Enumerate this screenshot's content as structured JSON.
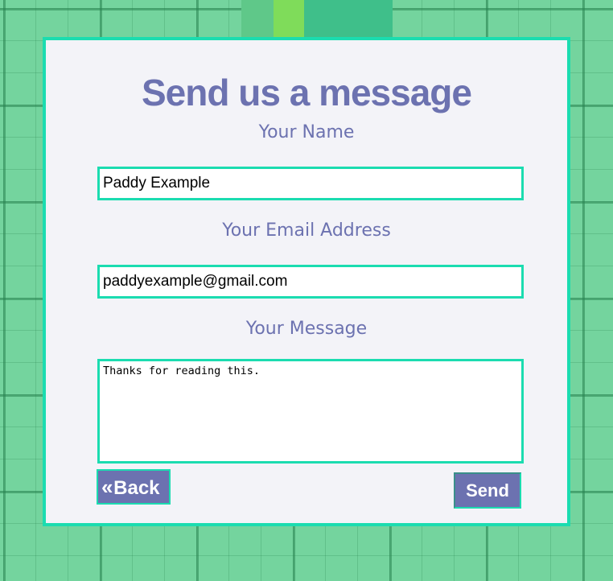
{
  "form": {
    "title": "Send us a message",
    "name_label": "Your Name",
    "name_value": "Paddy Example",
    "email_label": "Your Email Address",
    "email_value": "paddyexample@gmail.com",
    "message_label": "Your Message",
    "message_value": "Thanks for reading this.",
    "back_label": "Back",
    "back_icon": "double-chevron-left-icon",
    "send_label": "Send"
  },
  "colors": {
    "accent": "#1bdcb0",
    "brand": "#6c72b0",
    "card_background": "#f3f3f8"
  }
}
